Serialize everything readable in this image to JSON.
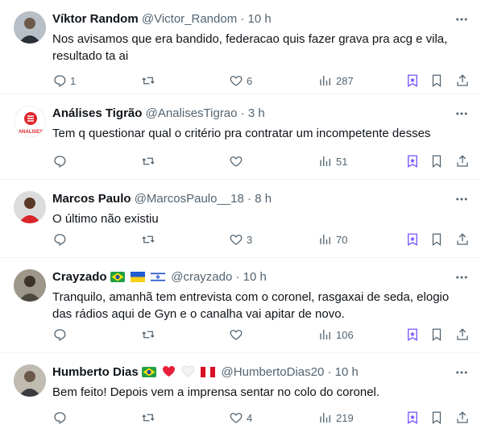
{
  "tweets": [
    {
      "name": "Víktor Random",
      "handle": "@Victor_Random",
      "dot": "·",
      "time": "10 h",
      "text": "Nos avisamos que era bandido, federacao quis fazer grava pra acg e vila, resultado ta ai",
      "replies": "1",
      "retweets": "",
      "likes": "6",
      "views": "287"
    },
    {
      "name": "Análises Tigrão",
      "handle": "@AnalisesTigrao",
      "dot": "·",
      "time": "3 h",
      "text": "Tem q questionar qual o critério pra contratar um incompetente desses",
      "replies": "",
      "retweets": "",
      "likes": "",
      "views": "51",
      "avatar_text": "ANALISES"
    },
    {
      "name": "Marcos Paulo",
      "handle": "@MarcosPaulo__18",
      "dot": "·",
      "time": "8 h",
      "text": "O último não existiu",
      "replies": "",
      "retweets": "",
      "likes": "3",
      "views": "70"
    },
    {
      "name": "Crayzado",
      "handle": "@crayzado",
      "dot": "·",
      "time": "10 h",
      "text": "Tranquilo, amanhã tem entrevista com o coronel, rasgaxai de seda, elogio das rádios aqui de Gyn e o canalha vai apitar de novo.",
      "replies": "",
      "retweets": "",
      "likes": "",
      "views": "106"
    },
    {
      "name": "Humberto Dias",
      "handle": "@HumbertoDias20",
      "dot": "·",
      "time": "10 h",
      "text": "Bem feito! Depois vem a imprensa sentar no colo do coronel.",
      "replies": "",
      "retweets": "",
      "likes": "4",
      "views": "219"
    }
  ],
  "icons": {
    "more": "more-icon",
    "reply": "reply-icon",
    "retweet": "retweet-icon",
    "like": "heart-icon",
    "views": "views-icon",
    "grok": "grok-icon",
    "bookmark": "bookmark-icon",
    "share": "share-icon"
  },
  "colors": {
    "text": "#0f1419",
    "muted": "#536471",
    "grok": "#7856ff",
    "divider": "#eff3f4"
  }
}
